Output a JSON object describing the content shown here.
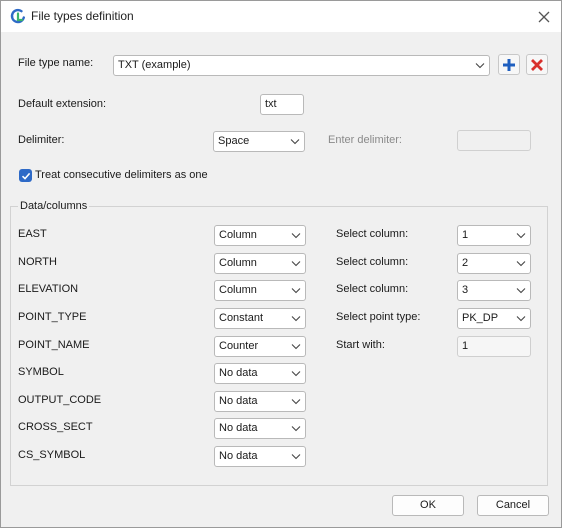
{
  "window": {
    "title": "File types definition"
  },
  "file_type": {
    "label": "File type name:",
    "value": "TXT (example)"
  },
  "default_extension": {
    "label": "Default extension:",
    "value": "txt"
  },
  "delimiter": {
    "label": "Delimiter:",
    "value": "Space",
    "enter_label": "Enter delimiter:",
    "enter_value": ""
  },
  "treat_consecutive": {
    "label": "Treat consecutive delimiters as one",
    "checked": true
  },
  "data_columns": {
    "legend": "Data/columns",
    "rows": [
      {
        "name": "EAST",
        "source": "Column",
        "right_label": "Select column:",
        "right_value": "1"
      },
      {
        "name": "NORTH",
        "source": "Column",
        "right_label": "Select column:",
        "right_value": "2"
      },
      {
        "name": "ELEVATION",
        "source": "Column",
        "right_label": "Select column:",
        "right_value": "3"
      },
      {
        "name": "POINT_TYPE",
        "source": "Constant",
        "right_label": "Select point type:",
        "right_value": "PK_DP"
      },
      {
        "name": "POINT_NAME",
        "source": "Counter",
        "right_label": "Start with:",
        "right_value": "1"
      },
      {
        "name": "SYMBOL",
        "source": "No data"
      },
      {
        "name": "OUTPUT_CODE",
        "source": "No data"
      },
      {
        "name": "CROSS_SECT",
        "source": "No data"
      },
      {
        "name": "CS_SYMBOL",
        "source": "No data"
      }
    ]
  },
  "footer": {
    "ok_label": "OK",
    "cancel_label": "Cancel"
  },
  "colors": {
    "accent": "#2e6ac7",
    "add_icon": "#1f5fbf",
    "delete_icon": "#d9302c"
  },
  "icons": {
    "title": "app-logo-icon",
    "add": "plus-icon",
    "delete": "x-delete-icon",
    "close": "close-icon"
  }
}
